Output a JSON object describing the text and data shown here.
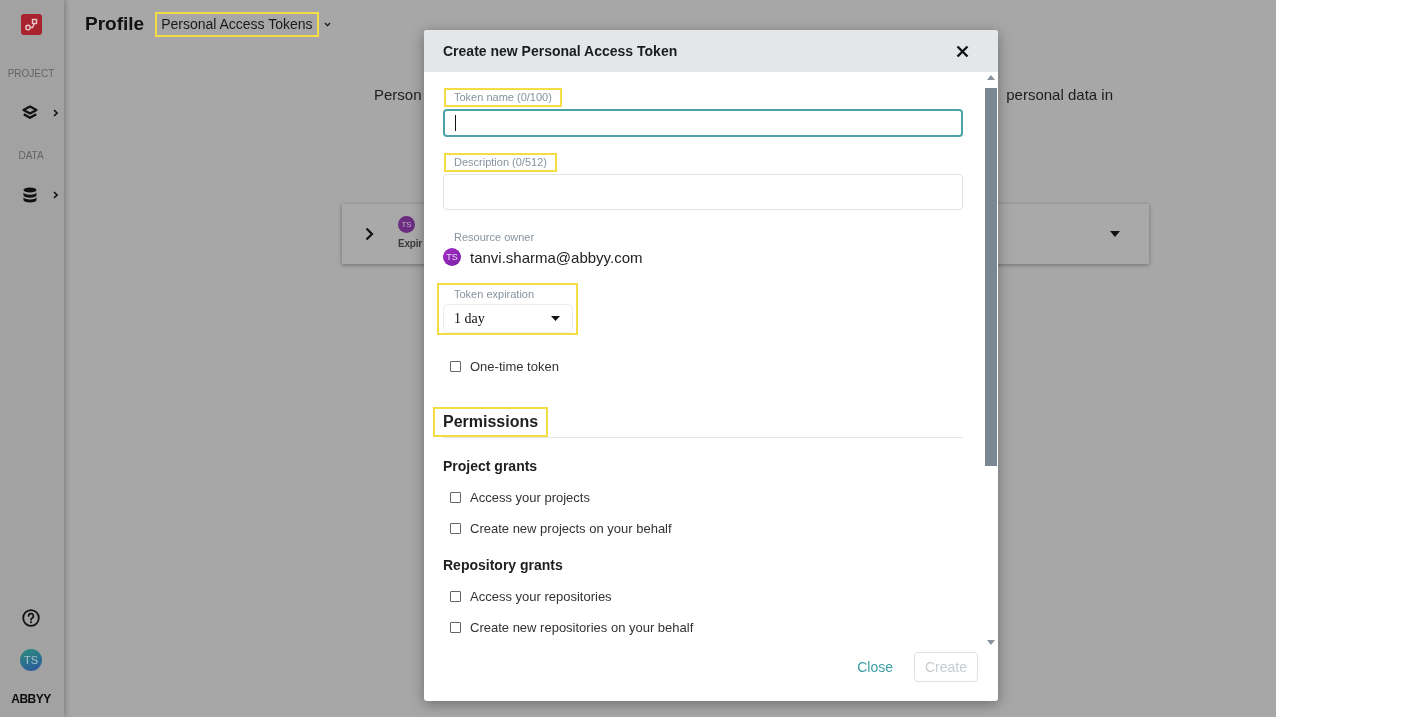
{
  "sidebar": {
    "sections": [
      {
        "label": "PROJECT"
      },
      {
        "label": "DATA"
      }
    ],
    "user_avatar": "TS",
    "brand": "ABBYY"
  },
  "header": {
    "title": "Profile",
    "dropdown": {
      "value": "Personal Access Tokens",
      "highlighted": true
    }
  },
  "page": {
    "intro": [
      "Person",
      "personal data in"
    ],
    "token_card": {
      "avatar": "TS",
      "subtitle": "Expir"
    }
  },
  "dialog": {
    "title": "Create new Personal Access Token",
    "fields": [
      {
        "kind": "text",
        "label": "Token name (0/100)",
        "focused": true,
        "highlighted": true
      },
      {
        "kind": "textarea",
        "label": "Description (0/512)",
        "focused": false,
        "highlighted": true
      }
    ],
    "resource_owner": {
      "label": "Resource owner",
      "avatar": "TS",
      "email": "tanvi.sharma@abbyy.com"
    },
    "expiration": {
      "label": "Token expiration",
      "value": "1 day",
      "highlighted": true
    },
    "one_time": {
      "label": "One-time token",
      "checked": false
    },
    "permissions": {
      "title": "Permissions",
      "highlighted": true,
      "groups": [
        {
          "title": "Project grants",
          "options": [
            {
              "label": "Access your projects",
              "checked": false
            },
            {
              "label": "Create new projects on your behalf",
              "checked": false
            }
          ]
        },
        {
          "title": "Repository grants",
          "options": [
            {
              "label": "Access your repositories",
              "checked": false
            },
            {
              "label": "Create new repositories on your behalf",
              "checked": false
            }
          ]
        }
      ]
    },
    "buttons": [
      {
        "kind": "link",
        "label": "Close",
        "disabled": false
      },
      {
        "kind": "outlined",
        "label": "Create",
        "disabled": true
      }
    ]
  }
}
